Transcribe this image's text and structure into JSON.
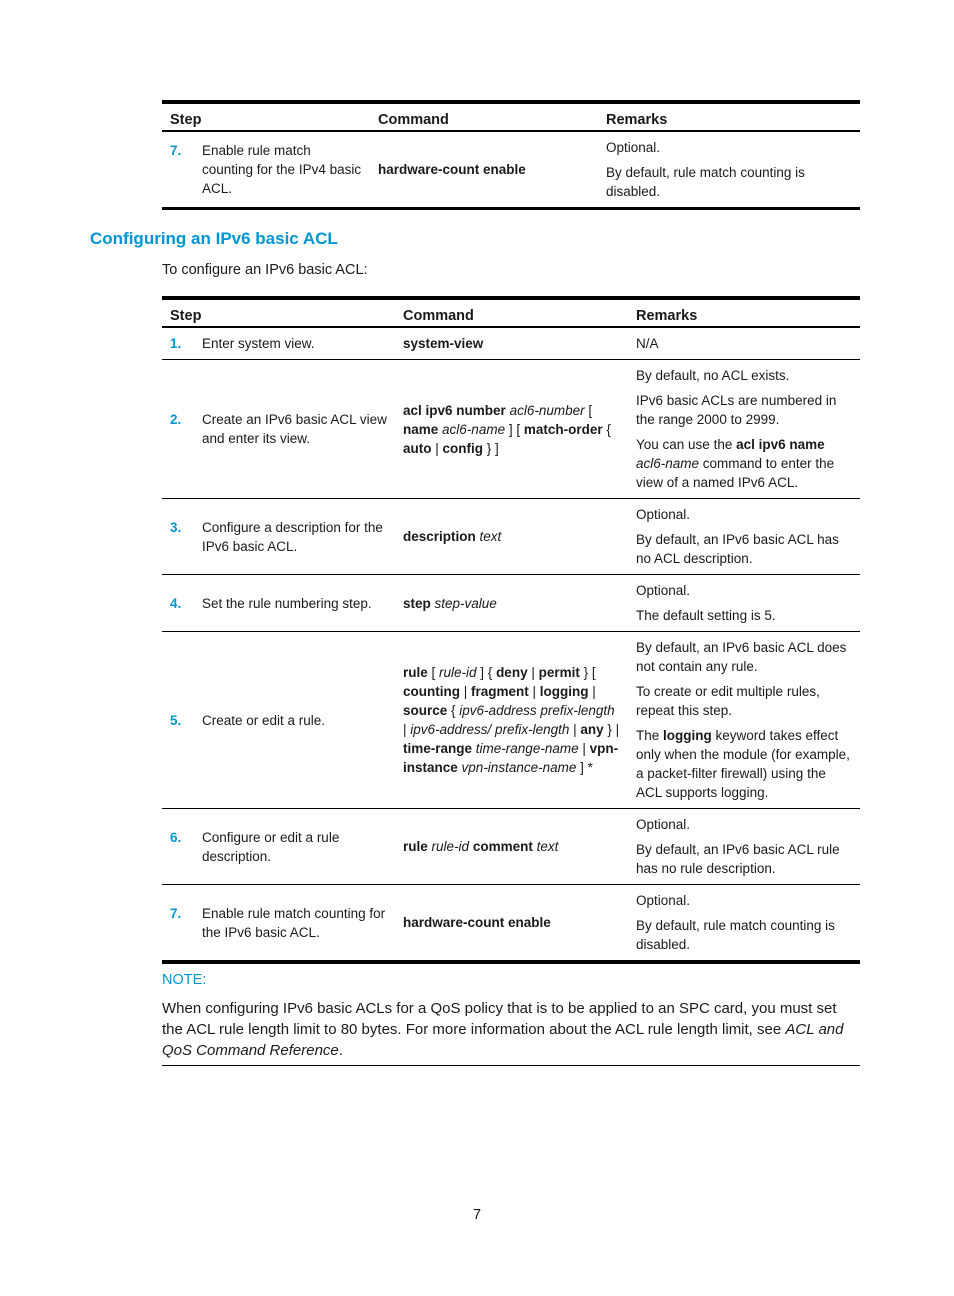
{
  "table1": {
    "headers": [
      "Step",
      "Command",
      "Remarks"
    ],
    "rows": [
      {
        "num": "7.",
        "step": "Enable rule match counting for the IPv4 basic ACL.",
        "command_html_parts": [
          {
            "t": "hardware-count enable",
            "s": "b"
          }
        ],
        "remarks": [
          "Optional.",
          "By default, rule match counting is disabled."
        ]
      }
    ]
  },
  "section": {
    "title": "Configuring an IPv6 basic ACL",
    "intro": "To configure an IPv6 basic ACL:"
  },
  "table2": {
    "headers": [
      "Step",
      "Command",
      "Remarks"
    ],
    "rows": [
      {
        "num": "1.",
        "step": "Enter system view.",
        "command": [
          {
            "t": "system-view",
            "s": "b"
          }
        ],
        "remarks": [
          [
            {
              "t": "N/A"
            }
          ]
        ]
      },
      {
        "num": "2.",
        "step": "Create an IPv6 basic ACL view and enter its view.",
        "command": [
          {
            "t": "acl ipv6 number",
            "s": "b"
          },
          {
            "t": " "
          },
          {
            "t": "acl6-number",
            "s": "i"
          },
          {
            "t": " [ "
          },
          {
            "t": "name",
            "s": "b"
          },
          {
            "t": " "
          },
          {
            "t": "acl6-name",
            "s": "i"
          },
          {
            "t": " ] [ "
          },
          {
            "t": "match-order",
            "s": "b"
          },
          {
            "t": " { "
          },
          {
            "t": "auto",
            "s": "b"
          },
          {
            "t": " | "
          },
          {
            "t": "config",
            "s": "b"
          },
          {
            "t": " } ]"
          }
        ],
        "remarks": [
          [
            {
              "t": "By default, no ACL exists."
            }
          ],
          [
            {
              "t": "IPv6 basic ACLs are numbered in the range 2000 to 2999."
            }
          ],
          [
            {
              "t": "You can use the "
            },
            {
              "t": "acl ipv6 name",
              "s": "b"
            },
            {
              "t": " "
            },
            {
              "t": "acl6-name",
              "s": "i"
            },
            {
              "t": " command to enter the view of a named IPv6 ACL."
            }
          ]
        ]
      },
      {
        "num": "3.",
        "step": "Configure a description for the IPv6 basic ACL.",
        "command": [
          {
            "t": "description",
            "s": "b"
          },
          {
            "t": " "
          },
          {
            "t": "text",
            "s": "i"
          }
        ],
        "remarks": [
          [
            {
              "t": "Optional."
            }
          ],
          [
            {
              "t": "By default, an IPv6 basic ACL has no ACL description."
            }
          ]
        ]
      },
      {
        "num": "4.",
        "step": "Set the rule numbering step.",
        "command": [
          {
            "t": "step",
            "s": "b"
          },
          {
            "t": " "
          },
          {
            "t": "step-value",
            "s": "i"
          }
        ],
        "remarks": [
          [
            {
              "t": "Optional."
            }
          ],
          [
            {
              "t": "The default setting is 5."
            }
          ]
        ]
      },
      {
        "num": "5.",
        "step": "Create or edit a rule.",
        "command": [
          {
            "t": "rule",
            "s": "b"
          },
          {
            "t": " [ "
          },
          {
            "t": "rule-id",
            "s": "i"
          },
          {
            "t": " ] { "
          },
          {
            "t": "deny",
            "s": "b"
          },
          {
            "t": " | "
          },
          {
            "t": "permit",
            "s": "b"
          },
          {
            "t": " } [ "
          },
          {
            "t": "counting",
            "s": "b"
          },
          {
            "t": " | "
          },
          {
            "t": "fragment",
            "s": "b"
          },
          {
            "t": " | "
          },
          {
            "t": "logging",
            "s": "b"
          },
          {
            "t": " | "
          },
          {
            "t": "source",
            "s": "b"
          },
          {
            "t": " { "
          },
          {
            "t": "ipv6-address prefix-length",
            "s": "i"
          },
          {
            "t": " | "
          },
          {
            "t": "ipv6-address/ prefix-length",
            "s": "i"
          },
          {
            "t": " | "
          },
          {
            "t": "any",
            "s": "b"
          },
          {
            "t": " } | "
          },
          {
            "t": "time-range",
            "s": "b"
          },
          {
            "t": " "
          },
          {
            "t": "time-range-name",
            "s": "i"
          },
          {
            "t": " | "
          },
          {
            "t": "vpn-instance",
            "s": "b"
          },
          {
            "t": " "
          },
          {
            "t": "vpn-instance-name",
            "s": "i"
          },
          {
            "t": " ] *"
          }
        ],
        "remarks": [
          [
            {
              "t": "By default, an IPv6 basic ACL does not contain any rule."
            }
          ],
          [
            {
              "t": "To create or edit multiple rules, repeat this step."
            }
          ],
          [
            {
              "t": "The "
            },
            {
              "t": "logging",
              "s": "b"
            },
            {
              "t": " keyword takes effect only when the module (for example, a packet-filter firewall) using the ACL supports logging."
            }
          ]
        ]
      },
      {
        "num": "6.",
        "step": "Configure or edit a rule description.",
        "command": [
          {
            "t": "rule",
            "s": "b"
          },
          {
            "t": " "
          },
          {
            "t": "rule-id",
            "s": "i"
          },
          {
            "t": " "
          },
          {
            "t": "comment",
            "s": "b"
          },
          {
            "t": " "
          },
          {
            "t": "text",
            "s": "i"
          }
        ],
        "remarks": [
          [
            {
              "t": "Optional."
            }
          ],
          [
            {
              "t": "By default, an IPv6 basic ACL rule has no rule description."
            }
          ]
        ]
      },
      {
        "num": "7.",
        "step": "Enable rule match counting for the IPv6 basic ACL.",
        "command": [
          {
            "t": "hardware-count enable",
            "s": "b"
          }
        ],
        "remarks": [
          [
            {
              "t": "Optional."
            }
          ],
          [
            {
              "t": "By default, rule match counting is disabled."
            }
          ]
        ]
      }
    ]
  },
  "note": {
    "label": "NOTE:",
    "body": [
      {
        "t": "When configuring IPv6 basic ACLs for a QoS policy that is to be applied to an SPC card, you must set the ACL rule length limit to 80 bytes. For more information about the ACL rule length limit, see "
      },
      {
        "t": "ACL and QoS Command Reference",
        "s": "i"
      },
      {
        "t": "."
      }
    ]
  },
  "page_number": "7",
  "colors": {
    "accent": "#0096d6",
    "text": "#1a1a1a",
    "rule": "#000000"
  }
}
